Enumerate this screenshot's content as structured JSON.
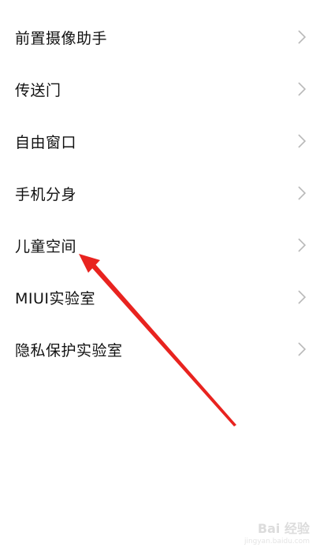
{
  "menu": {
    "items": [
      {
        "label": "前置摄像助手"
      },
      {
        "label": "传送门"
      },
      {
        "label": "自由窗口"
      },
      {
        "label": "手机分身"
      },
      {
        "label": "儿童空间"
      },
      {
        "label": "MIUI实验室"
      },
      {
        "label": "隐私保护实验室"
      }
    ],
    "chevron_icon": "chevron-right-icon"
  },
  "annotation": {
    "color": "#e8231f",
    "points_to": "儿童空间"
  },
  "watermark": {
    "logo": "Bai 经验",
    "subtitle": "jingyan.baidu.com"
  }
}
